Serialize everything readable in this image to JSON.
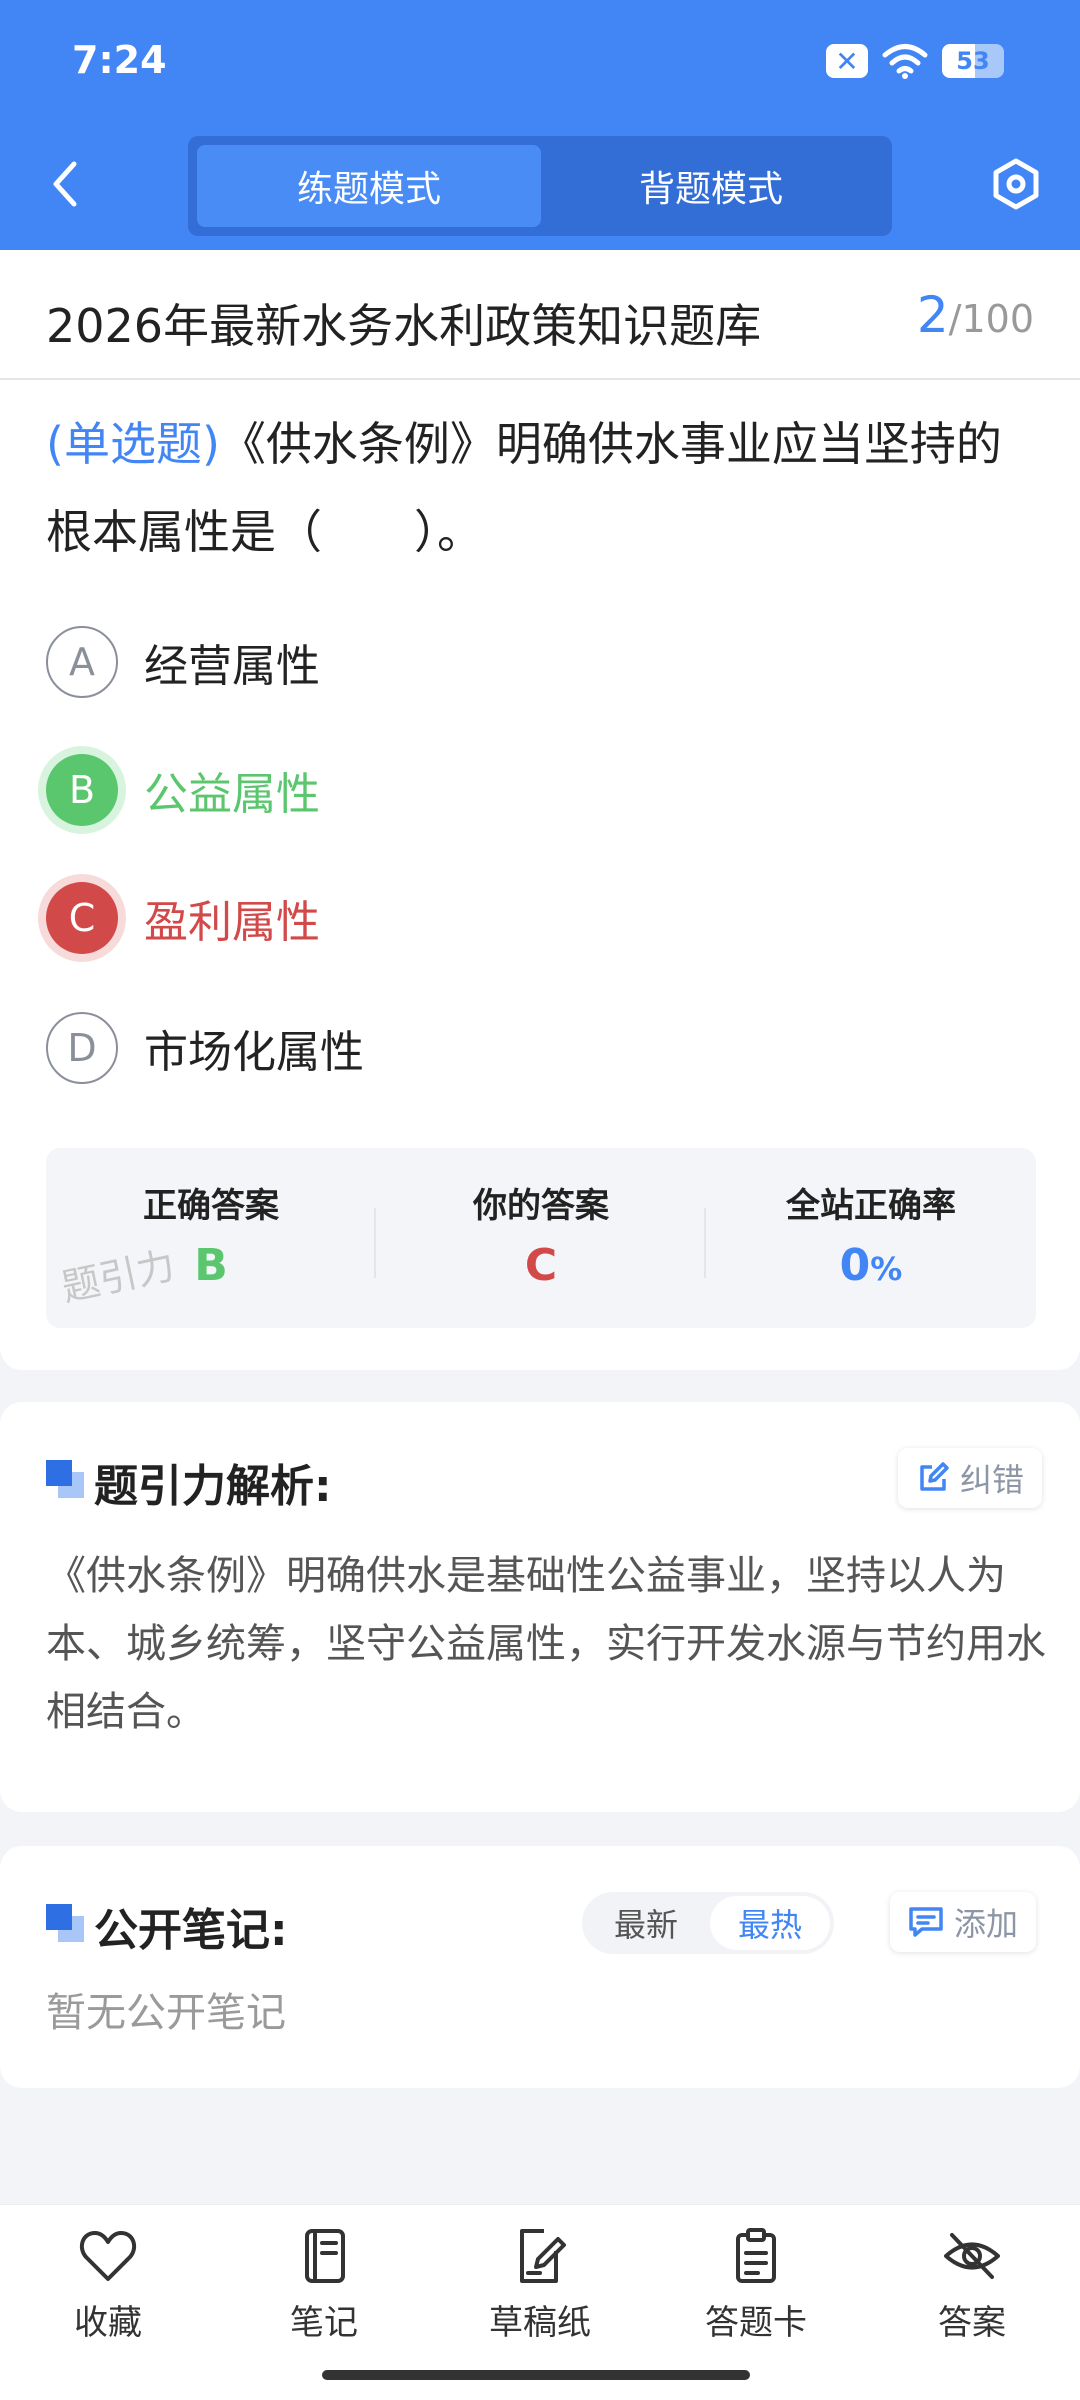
{
  "status_bar": {
    "time": "7:24",
    "battery": "53"
  },
  "header": {
    "mode_tabs": [
      {
        "label": "练题模式",
        "active": true
      },
      {
        "label": "背题模式",
        "active": false
      }
    ]
  },
  "bank": {
    "title": "2026年最新水务水利政策知识题库",
    "current": "2",
    "total": "/100"
  },
  "question": {
    "type_label": "(单选题)",
    "text": "《供水条例》明确供水事业应当坚持的根本属性是（　　）。",
    "options": [
      {
        "letter": "A",
        "text": "经营属性",
        "state": "normal"
      },
      {
        "letter": "B",
        "text": "公益属性",
        "state": "correct"
      },
      {
        "letter": "C",
        "text": "盈利属性",
        "state": "wrong"
      },
      {
        "letter": "D",
        "text": "市场化属性",
        "state": "normal"
      }
    ]
  },
  "answer_summary": {
    "correct_label": "正确答案",
    "correct_value": "B",
    "yours_label": "你的答案",
    "yours_value": "C",
    "rate_label": "全站正确率",
    "rate_value": "0",
    "rate_unit": "%",
    "watermark": "题引力"
  },
  "analysis": {
    "title": "题引力解析:",
    "report_label": "纠错",
    "text": "《供水条例》明确供水是基础性公益事业，坚持以人为本、城乡统筹，坚守公益属性，实行开发水源与节约用水相结合。"
  },
  "notes": {
    "title": "公开笔记:",
    "sort_options": [
      "最新",
      "最热"
    ],
    "active_sort": "最热",
    "add_label": "添加",
    "empty_text": "暂无公开笔记"
  },
  "bottom_nav": [
    {
      "label": "收藏",
      "icon": "heart-icon"
    },
    {
      "label": "笔记",
      "icon": "notebook-icon"
    },
    {
      "label": "草稿纸",
      "icon": "draft-paper-icon"
    },
    {
      "label": "答题卡",
      "icon": "answer-sheet-icon"
    },
    {
      "label": "答案",
      "icon": "eye-off-icon"
    }
  ],
  "colors": {
    "primary": "#4285f4",
    "correct": "#5ac66e",
    "wrong": "#d2494a"
  }
}
